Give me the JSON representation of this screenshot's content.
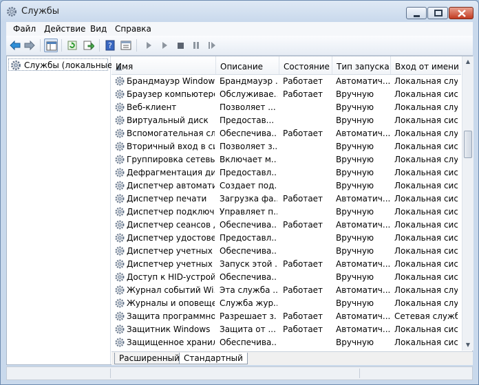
{
  "window": {
    "title": "Службы"
  },
  "menu": [
    "Файл",
    "Действие",
    "Вид",
    "Справка"
  ],
  "tree": {
    "root_label": "Службы (локальные)"
  },
  "columns": [
    "Имя",
    "Описание",
    "Состояние",
    "Тип запуска",
    "Вход от имени"
  ],
  "rows": [
    [
      "Брандмауэр Windows",
      "Брандмауэр ...",
      "Работает",
      "Автоматич...",
      "Локальная слу..."
    ],
    [
      "Браузер компьютеров",
      "Обслуживае...",
      "Работает",
      "Вручную",
      "Локальная сист..."
    ],
    [
      "Веб-клиент",
      "Позволяет ...",
      "",
      "Вручную",
      "Локальная слу..."
    ],
    [
      "Виртуальный диск",
      "Предостав...",
      "",
      "Вручную",
      "Локальная сист..."
    ],
    [
      "Вспомогательная сл...",
      "Обеспечива...",
      "Работает",
      "Автоматич...",
      "Локальная слу..."
    ],
    [
      "Вторичный вход в си...",
      "Позволяет з...",
      "",
      "Вручную",
      "Локальная сист..."
    ],
    [
      "Группировка сетевых...",
      "Включает м...",
      "",
      "Вручную",
      "Локальная слу..."
    ],
    [
      "Дефрагментация дис...",
      "Предоставл...",
      "",
      "Вручную",
      "Локальная сист..."
    ],
    [
      "Диспетчер автомати...",
      "Создает под...",
      "",
      "Вручную",
      "Локальная сист..."
    ],
    [
      "Диспетчер печати",
      "Загрузка фа...",
      "Работает",
      "Автоматич...",
      "Локальная сист..."
    ],
    [
      "Диспетчер подключе...",
      "Управляет п...",
      "",
      "Вручную",
      "Локальная сист..."
    ],
    [
      "Диспетчер сеансов д...",
      "Обеспечива...",
      "Работает",
      "Автоматич...",
      "Локальная сист..."
    ],
    [
      "Диспетчер удостовер...",
      "Предоставл...",
      "",
      "Вручную",
      "Локальная сист..."
    ],
    [
      "Диспетчер учетных д...",
      "Обеспечива...",
      "",
      "Вручную",
      "Локальная сист..."
    ],
    [
      "Диспетчер учетных з...",
      "Запуск этой ...",
      "Работает",
      "Автоматич...",
      "Локальная сист..."
    ],
    [
      "Доступ к HID-устрой...",
      "Обеспечива...",
      "",
      "Вручную",
      "Локальная сист..."
    ],
    [
      "Журнал событий Wi...",
      "Эта служба ...",
      "Работает",
      "Автоматич...",
      "Локальная слу..."
    ],
    [
      "Журналы и оповеще...",
      "Служба жур...",
      "",
      "Вручную",
      "Локальная слу..."
    ],
    [
      "Защита программно...",
      "Разрешает з...",
      "Работает",
      "Автоматич...",
      "Сетевая служба"
    ],
    [
      "Защитник Windows",
      "Защита от ...",
      "Работает",
      "Автоматич...",
      "Локальная сист..."
    ],
    [
      "Защищенное хранил...",
      "Обеспечива...",
      "",
      "Вручную",
      "Локальная сист..."
    ]
  ],
  "tabs": [
    "Расширенный",
    "Стандартный"
  ],
  "colors": {
    "accent": "#3a6ea5",
    "selection_border": "#7d9bc2"
  }
}
